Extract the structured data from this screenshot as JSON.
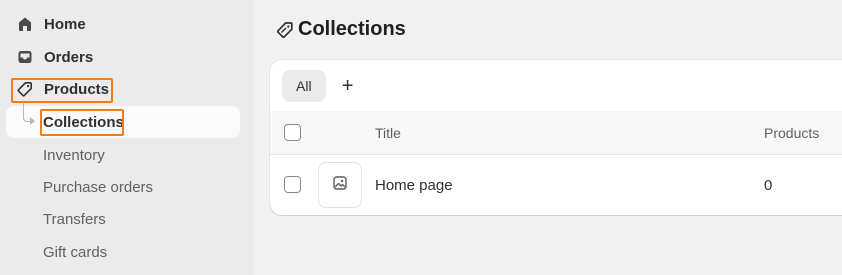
{
  "sidebar": {
    "items": [
      {
        "label": "Home",
        "icon": "home-icon"
      },
      {
        "label": "Orders",
        "icon": "inbox-icon"
      },
      {
        "label": "Products",
        "icon": "tag-icon"
      }
    ],
    "sub_items": [
      {
        "label": "Collections"
      },
      {
        "label": "Inventory"
      },
      {
        "label": "Purchase orders"
      },
      {
        "label": "Transfers"
      },
      {
        "label": "Gift cards"
      }
    ]
  },
  "main": {
    "title": "Collections",
    "title_icon": "collection-tag-icon",
    "tabs": [
      {
        "label": "All"
      }
    ],
    "add_tab": "+",
    "table": {
      "columns": [
        "Title",
        "Products"
      ],
      "rows": [
        {
          "title": "Home page",
          "products": "0",
          "thumb_icon": "image-icon"
        }
      ]
    }
  },
  "colors": {
    "highlight": "#ef7d1a",
    "sidebar_bg": "#ebebeb",
    "page_bg": "#f1f1f1"
  }
}
